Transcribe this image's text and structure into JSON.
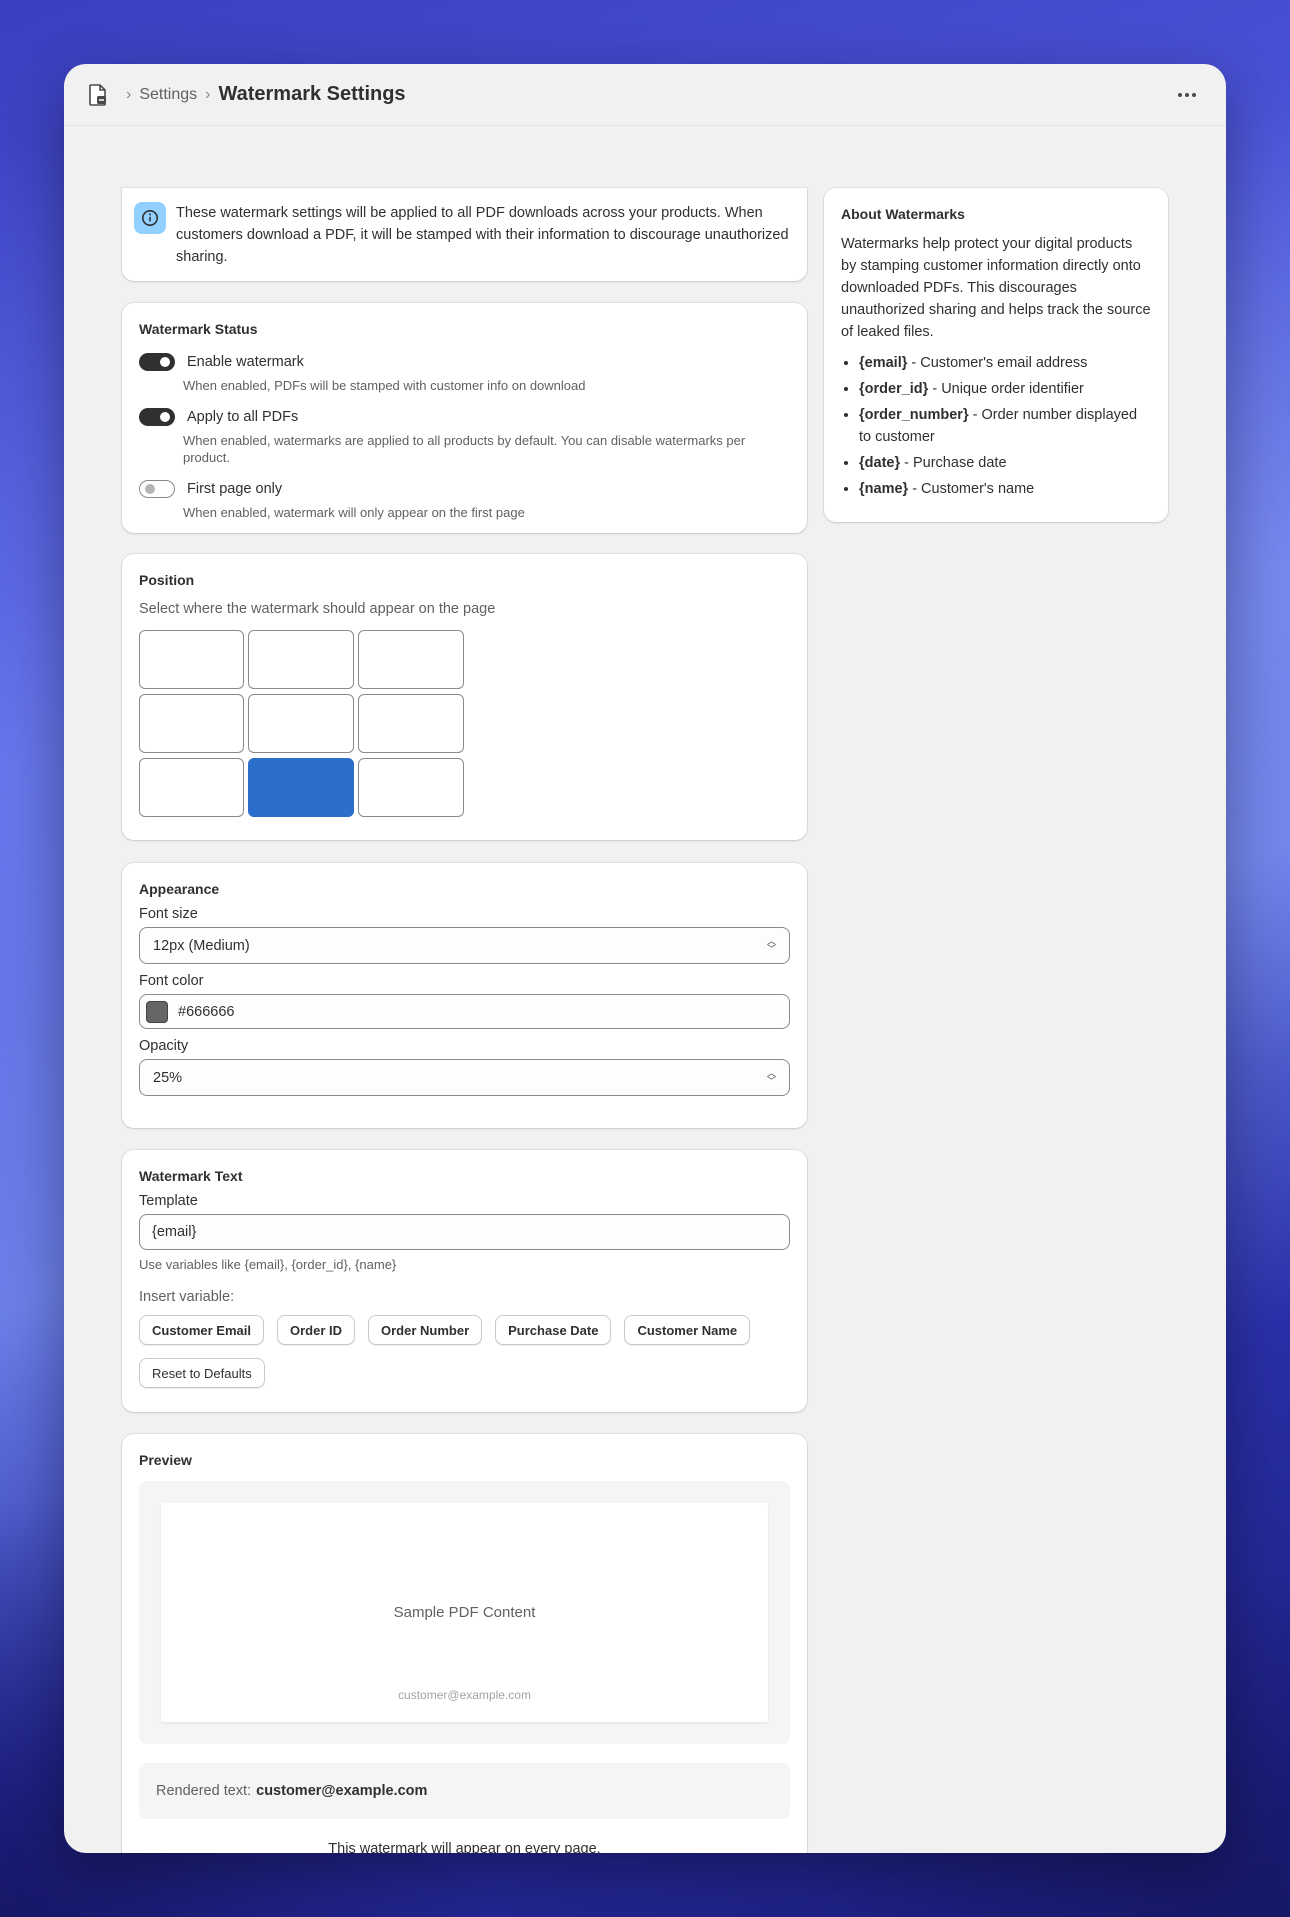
{
  "header": {
    "breadcrumb_settings": "Settings",
    "title": "Watermark Settings"
  },
  "info_banner": {
    "text": "These watermark settings will be applied to all PDF downloads across your products. When customers download a PDF, it will be stamped with their information to discourage unauthorized sharing."
  },
  "status": {
    "title": "Watermark Status",
    "toggles": [
      {
        "label": "Enable watermark",
        "help": "When enabled, PDFs will be stamped with customer info on download",
        "on": true
      },
      {
        "label": "Apply to all PDFs",
        "help": "When enabled, watermarks are applied to all products by default. You can disable watermarks per product.",
        "on": true
      },
      {
        "label": "First page only",
        "help": "When enabled, watermark will only appear on the first page",
        "on": false
      }
    ]
  },
  "position": {
    "title": "Position",
    "subtitle": "Select where the watermark should appear on the page",
    "selected": "bottom-center"
  },
  "appearance": {
    "title": "Appearance",
    "font_size_label": "Font size",
    "font_size_value": "12px (Medium)",
    "font_color_label": "Font color",
    "font_color_value": "#666666",
    "opacity_label": "Opacity",
    "opacity_value": "25%"
  },
  "watermark_text": {
    "title": "Watermark Text",
    "template_label": "Template",
    "template_value": "{email}",
    "hint": "Use variables like {email}, {order_id}, {name}",
    "insert_label": "Insert variable:",
    "variable_buttons": [
      "Customer Email",
      "Order ID",
      "Order Number",
      "Purchase Date",
      "Customer Name"
    ],
    "reset_label": "Reset to Defaults"
  },
  "preview": {
    "title": "Preview",
    "sample_content": "Sample PDF Content",
    "watermark_sample": "customer@example.com",
    "rendered_label": "Rendered text:",
    "rendered_value": "customer@example.com",
    "every_page_note": "This watermark will appear on every page."
  },
  "about": {
    "title": "About Watermarks",
    "body": "Watermarks help protect your digital products by stamping customer information directly onto downloaded PDFs. This discourages unauthorized sharing and helps track the source of leaked files.",
    "items": [
      {
        "var": "{email}",
        "desc": " - Customer's email address"
      },
      {
        "var": "{order_id}",
        "desc": " - Unique order identifier"
      },
      {
        "var": "{order_number}",
        "desc": " - Order number displayed to customer"
      },
      {
        "var": "{date}",
        "desc": " - Purchase date"
      },
      {
        "var": "{name}",
        "desc": " - Customer's name"
      }
    ]
  },
  "colors": {
    "accent": "#2c6ecb",
    "info_icon_bg": "#91d0ff",
    "toggle_on": "#303030"
  }
}
